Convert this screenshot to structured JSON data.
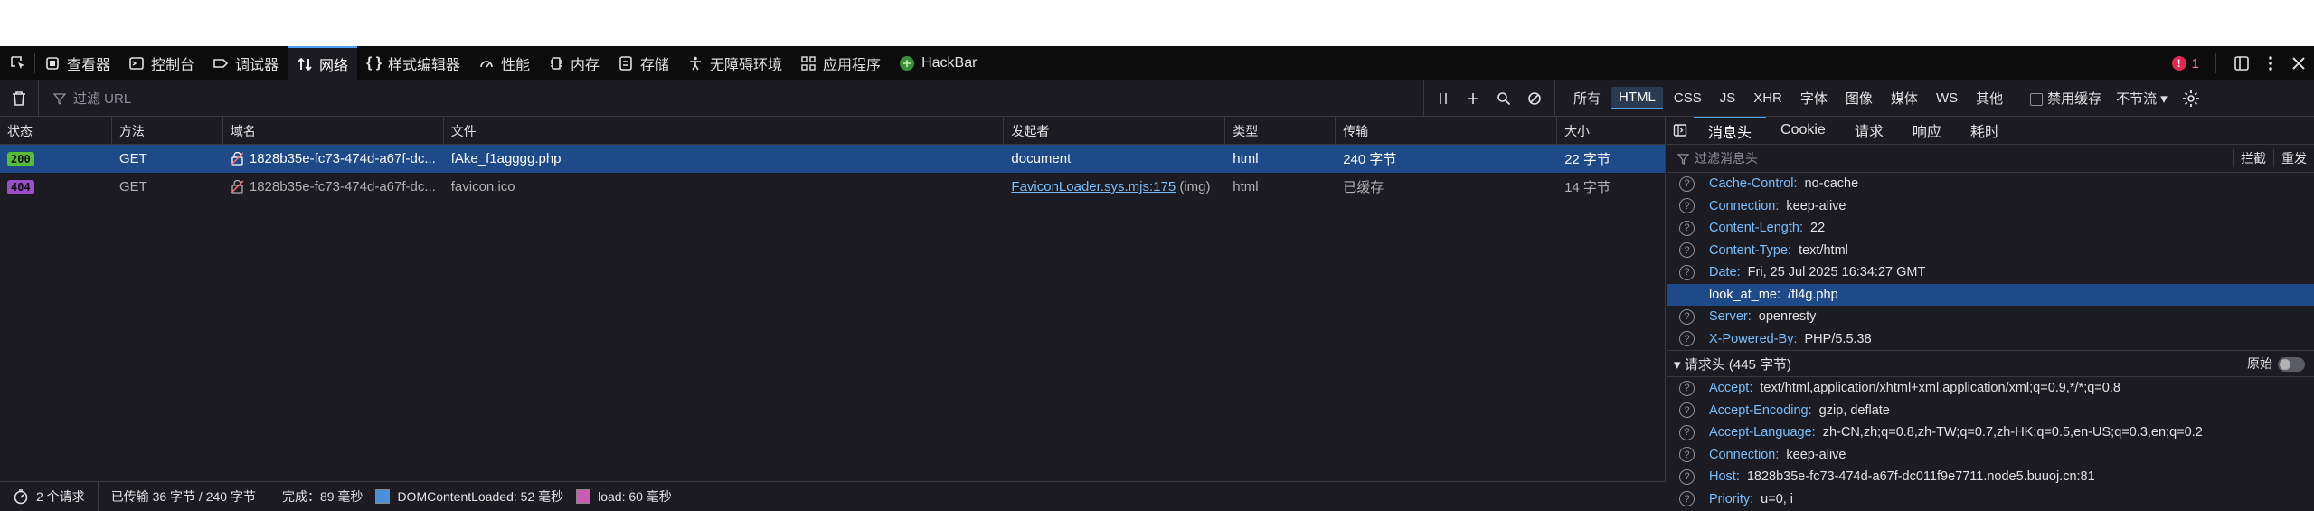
{
  "toolbar": {
    "tabs": [
      {
        "label": "查看器",
        "icon": "inspector-icon"
      },
      {
        "label": "控制台",
        "icon": "console-icon"
      },
      {
        "label": "调试器",
        "icon": "debugger-icon"
      },
      {
        "label": "网络",
        "icon": "network-icon",
        "active": true
      },
      {
        "label": "样式编辑器",
        "icon": "style-editor-icon"
      },
      {
        "label": "性能",
        "icon": "performance-icon"
      },
      {
        "label": "内存",
        "icon": "memory-icon"
      },
      {
        "label": "存储",
        "icon": "storage-icon"
      },
      {
        "label": "无障碍环境",
        "icon": "accessibility-icon"
      },
      {
        "label": "应用程序",
        "icon": "application-icon"
      },
      {
        "label": "HackBar",
        "icon": "hackbar-icon"
      }
    ],
    "error_count": "1"
  },
  "filter": {
    "placeholder": "过滤 URL",
    "types": [
      "所有",
      "HTML",
      "CSS",
      "JS",
      "XHR",
      "字体",
      "图像",
      "媒体",
      "WS",
      "其他"
    ],
    "selected_type": "HTML",
    "disable_cache": "禁用缓存",
    "throttle": "不节流 ▾"
  },
  "table": {
    "headers": [
      "状态",
      "方法",
      "域名",
      "文件",
      "发起者",
      "类型",
      "传输",
      "大小"
    ],
    "rows": [
      {
        "status": "200",
        "method": "GET",
        "domain": "1828b35e-fc73-474d-a67f-dc...",
        "file": "fAke_f1agggg.php",
        "initiator": "document",
        "initiator_extra": "",
        "type": "html",
        "transfer": "240 字节",
        "size": "22 字节"
      },
      {
        "status": "404",
        "method": "GET",
        "domain": "1828b35e-fc73-474d-a67f-dc...",
        "file": "favicon.ico",
        "initiator": "FaviconLoader.sys.mjs:175",
        "initiator_extra": " (img)",
        "type": "html",
        "transfer": "已缓存",
        "size": "14 字节"
      }
    ]
  },
  "footer": {
    "requests": "2 个请求",
    "transferred": "已传输 36 字节 / 240 字节",
    "finish": "完成：89 毫秒",
    "dom_loaded": "DOMContentLoaded: 52 毫秒",
    "load": "load: 60 毫秒"
  },
  "details": {
    "tabs": [
      "消息头",
      "Cookie",
      "请求",
      "响应",
      "耗时"
    ],
    "filter_placeholder": "过滤消息头",
    "block_label": "拦截",
    "resend_label": "重发",
    "response_headers": [
      {
        "name": "Cache-Control:",
        "value": "no-cache"
      },
      {
        "name": "Connection:",
        "value": "keep-alive"
      },
      {
        "name": "Content-Length:",
        "value": "22"
      },
      {
        "name": "Content-Type:",
        "value": "text/html"
      },
      {
        "name": "Date:",
        "value": "Fri, 25 Jul 2025 16:34:27 GMT"
      },
      {
        "name": "look_at_me:",
        "value": "/fl4g.php",
        "highlight": true
      },
      {
        "name": "Server:",
        "value": "openresty"
      },
      {
        "name": "X-Powered-By:",
        "value": "PHP/5.5.38"
      }
    ],
    "request_section": "▾ 请求头 (445 字节)",
    "raw_label": "原始",
    "request_headers": [
      {
        "name": "Accept:",
        "value": "text/html,application/xhtml+xml,application/xml;q=0.9,*/*;q=0.8"
      },
      {
        "name": "Accept-Encoding:",
        "value": "gzip, deflate"
      },
      {
        "name": "Accept-Language:",
        "value": "zh-CN,zh;q=0.8,zh-TW;q=0.7,zh-HK;q=0.5,en-US;q=0.3,en;q=0.2"
      },
      {
        "name": "Connection:",
        "value": "keep-alive"
      },
      {
        "name": "Host:",
        "value": "1828b35e-fc73-474d-a67f-dc011f9e7711.node5.buuoj.cn:81"
      },
      {
        "name": "Priority:",
        "value": "u=0, i"
      }
    ]
  },
  "colors": {
    "accent": "#4ea1ff",
    "selection": "#1f4a8a",
    "status_ok": "#57bd35",
    "status_404": "#9a4ec8"
  }
}
